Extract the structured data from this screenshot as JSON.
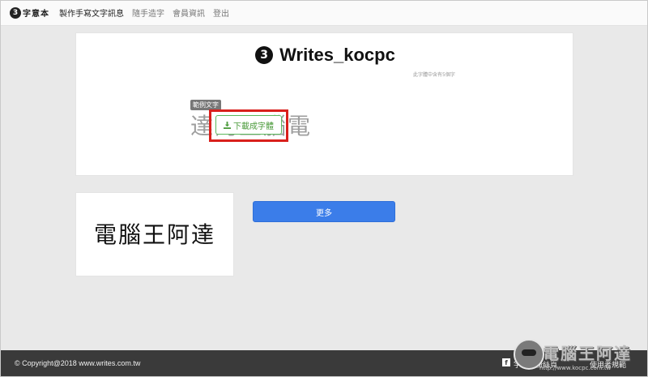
{
  "nav": {
    "brand": "字意本",
    "links": [
      "製作手寫文字訊息",
      "隨手造字",
      "會員資訊",
      "登出"
    ]
  },
  "font_card": {
    "title": "Writes_kocpc",
    "char_count": "此字體中含有5個字",
    "sample_label": "範例文字",
    "sample_text": "達阿王腦電",
    "download_label": "下載成字體"
  },
  "preview": {
    "text": "電腦王阿達"
  },
  "more_label": "更多",
  "footer": {
    "copyright": "© Copyright@2018 www.writes.com.tw",
    "links": [
      "字意本粉絲頁",
      "使用者規範"
    ]
  },
  "watermark": {
    "text": "電腦王阿達",
    "url": "http://www.kocpc.com.tw"
  },
  "colors": {
    "accent_blue": "#3b7de9",
    "download_green": "#5cb85c",
    "highlight_red": "#d9201c",
    "footer_bg": "#3a3a3a"
  }
}
